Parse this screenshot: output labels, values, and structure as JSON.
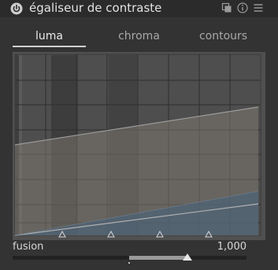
{
  "header": {
    "title": "égaliseur de contraste",
    "icons": [
      "power-icon",
      "presets-icon",
      "reset-icon",
      "menu-icon"
    ]
  },
  "tabs": [
    {
      "label": "luma",
      "active": true
    },
    {
      "label": "chroma",
      "active": false
    },
    {
      "label": "contours",
      "active": false
    }
  ],
  "fusion": {
    "label": "fusion",
    "value": "1,000"
  },
  "colors": {
    "background": "#333333",
    "header": "#2b2b2b",
    "graph_background": "#505050",
    "curve_upper": "#8e8e8e",
    "curve_lower": "#55606b"
  }
}
